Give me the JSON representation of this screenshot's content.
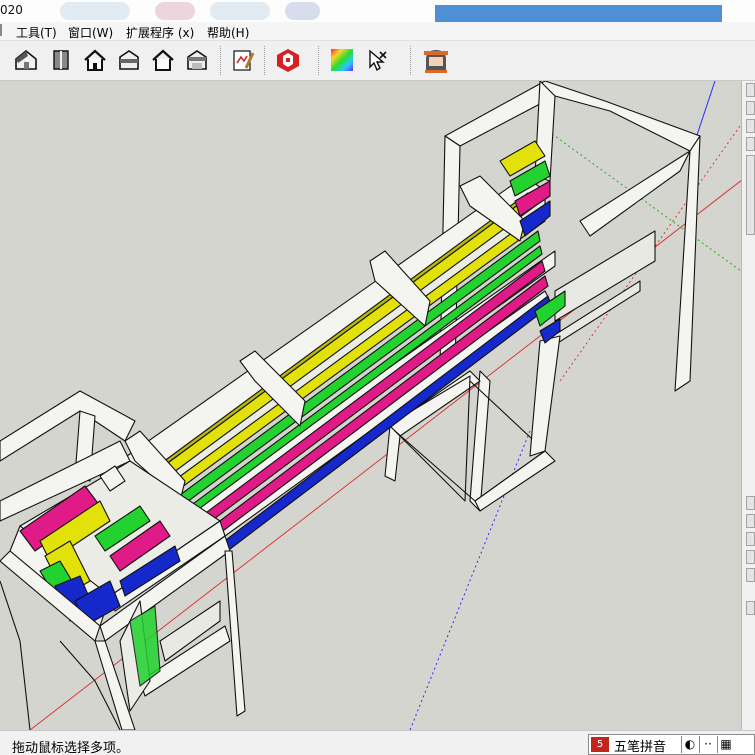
{
  "window": {
    "title_fragment": "020"
  },
  "menu": {
    "items": [
      {
        "label": "工具(T)"
      },
      {
        "label": "窗口(W)"
      },
      {
        "label": "扩展程序 (x)"
      },
      {
        "label": "帮助(H)"
      }
    ]
  },
  "toolbar": {
    "tools": [
      {
        "icon": "iso-view-icon"
      },
      {
        "icon": "top-view-icon"
      },
      {
        "icon": "front-view-icon"
      },
      {
        "icon": "right-view-icon"
      },
      {
        "icon": "back-view-icon"
      },
      {
        "icon": "left-view-icon"
      },
      {
        "icon": "edit-drawing-icon"
      },
      {
        "icon": "extension-warehouse-icon"
      },
      {
        "icon": "materials-gradient-icon"
      },
      {
        "icon": "select-cursor-icon"
      },
      {
        "icon": "user-avatar-icon"
      }
    ]
  },
  "viewport": {
    "background": "#d5d5cf",
    "model_colors": {
      "frame": "#f4f4f0",
      "yellow": "#e2e20a",
      "green": "#22d22e",
      "magenta": "#e01a86",
      "blue": "#1428cc"
    },
    "axes": {
      "red": "#d81f1f",
      "green": "#1fae1f",
      "blue": "#2c2cff"
    }
  },
  "statusbar": {
    "hint": "拖动鼠标选择多项。"
  },
  "ime": {
    "logo": "5",
    "name": "五笔拼音",
    "mode": "◐",
    "punct": "··",
    "keyboard": "▦"
  }
}
